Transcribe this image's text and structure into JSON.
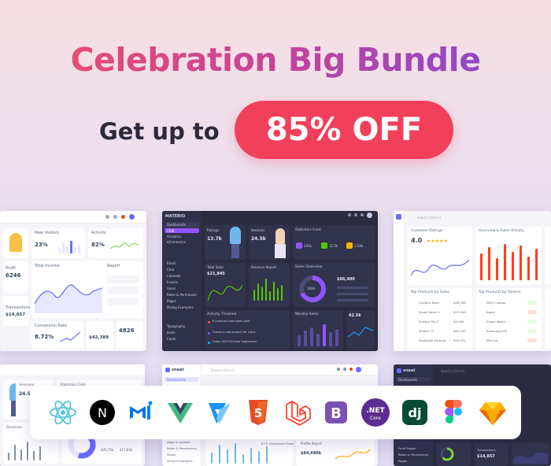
{
  "headline": "Celebration Big Bundle",
  "subline": "Get up to",
  "discount": "85% OFF",
  "colors": {
    "headline_gradient": [
      "#f24f6a",
      "#c64398",
      "#7d4ad8"
    ],
    "pill": "#f23f5c",
    "primary": "#696cff",
    "dark_bg": "#2b2c40"
  },
  "dash_left": {
    "new_visitors": "New Visitors",
    "activity": "Activity",
    "visitors_value": "23%",
    "activity_value": "82%",
    "profit": "Profit",
    "profit_value": "6246",
    "total_income": "Total Income",
    "report": "Report",
    "transactions": "Transactions",
    "transactions_value": "$14,857",
    "conversion": "Conversion Rate",
    "conversion_value": "8.72%",
    "revenue_value": "$42,389",
    "sales_value": "4826"
  },
  "dash_center": {
    "brand": "MATERIO",
    "nav": [
      "Dashboards",
      "CRM",
      "Analytics",
      "eCommerce",
      "Email",
      "Chat",
      "Calendar",
      "Invoice",
      "Users",
      "Roles & Permission",
      "Pages",
      "Dialog Examples",
      "Typography",
      "Icons",
      "Cards"
    ],
    "ratings": "Ratings",
    "ratings_value": "13.7k",
    "sessions": "Sessions",
    "sessions_value": "24.5k",
    "statistics_card": "Statistics Card",
    "stat_sales": "245k",
    "stat_customers": "12.5k",
    "stat_product": "1.54k",
    "total_sales": "Total Sales",
    "total_sales_value": "$21,845",
    "revenue_report": "Revenue Report",
    "sales_overview": "Sales Overview",
    "donut_value": "100k",
    "sales_number": "$86,400",
    "activity_timeline": "Activity Timeline",
    "timeline_items": [
      "8 Invoices have been paid",
      "Create a new project for client",
      "Order #37745 from September"
    ],
    "weekly_sales": "Weekly Sales",
    "weekly_value": "42.5k"
  },
  "dash_right": {
    "customer_ratings": "Customer Ratings",
    "rating_value": "4.0",
    "overview": "Overview & Sales Activity",
    "top_products": "Top Products by Sales",
    "top_volume": "Top Products by Volume",
    "products": [
      "Oneplus Nord",
      "Smart Band 4",
      "Surface Pro X",
      "iPhone 13",
      "Bluetooth Earbuds"
    ],
    "prices": [
      "$98,348",
      "$15,459",
      "$4,589",
      "$84,345",
      "$10,374"
    ],
    "volume_items": [
      "ENVY Laptop",
      "Apple",
      "Smart Watch",
      "Samsung A72",
      "iPad Air"
    ]
  },
  "bottom_left": {
    "statistics_card": "Statistics Card",
    "sessions": "Sessions",
    "sessions_value": "24.5k",
    "revenue": "Revenue",
    "value_a": "$45,75k",
    "value_b": "$12,83k"
  },
  "bottom_center": {
    "brand": "sneat",
    "search": "Search (Ctrl+/)",
    "nav": [
      "Dashboards",
      "Apps & Layouts",
      "Roles & Permissions",
      "Pages",
      "Wizard Examples"
    ],
    "conversion": "87% Conversion Rate",
    "profile_report": "Profile Report",
    "profile_value": "$84,686k"
  },
  "bottom_right": {
    "brand": "sneat",
    "search": "Search (Ctrl+/)",
    "nav": [
      "Dashboards",
      "Front Pages",
      "Roles & Permissions",
      "Pages"
    ],
    "transactions": "Transactions",
    "transactions_value": "$14,857"
  },
  "tech_icons": [
    {
      "name": "react-icon",
      "label": ""
    },
    {
      "name": "nextjs-icon",
      "label": "N"
    },
    {
      "name": "mui-icon",
      "label": ""
    },
    {
      "name": "vue-icon",
      "label": ""
    },
    {
      "name": "vuetify-icon",
      "label": ""
    },
    {
      "name": "html5-icon",
      "label": "5"
    },
    {
      "name": "laravel-icon",
      "label": ""
    },
    {
      "name": "bootstrap-icon",
      "label": "B"
    },
    {
      "name": "dotnet-icon",
      "label": ".NET",
      "sub": "Core"
    },
    {
      "name": "django-icon",
      "label": "dj"
    },
    {
      "name": "figma-icon",
      "label": ""
    },
    {
      "name": "sketch-icon",
      "label": ""
    }
  ]
}
